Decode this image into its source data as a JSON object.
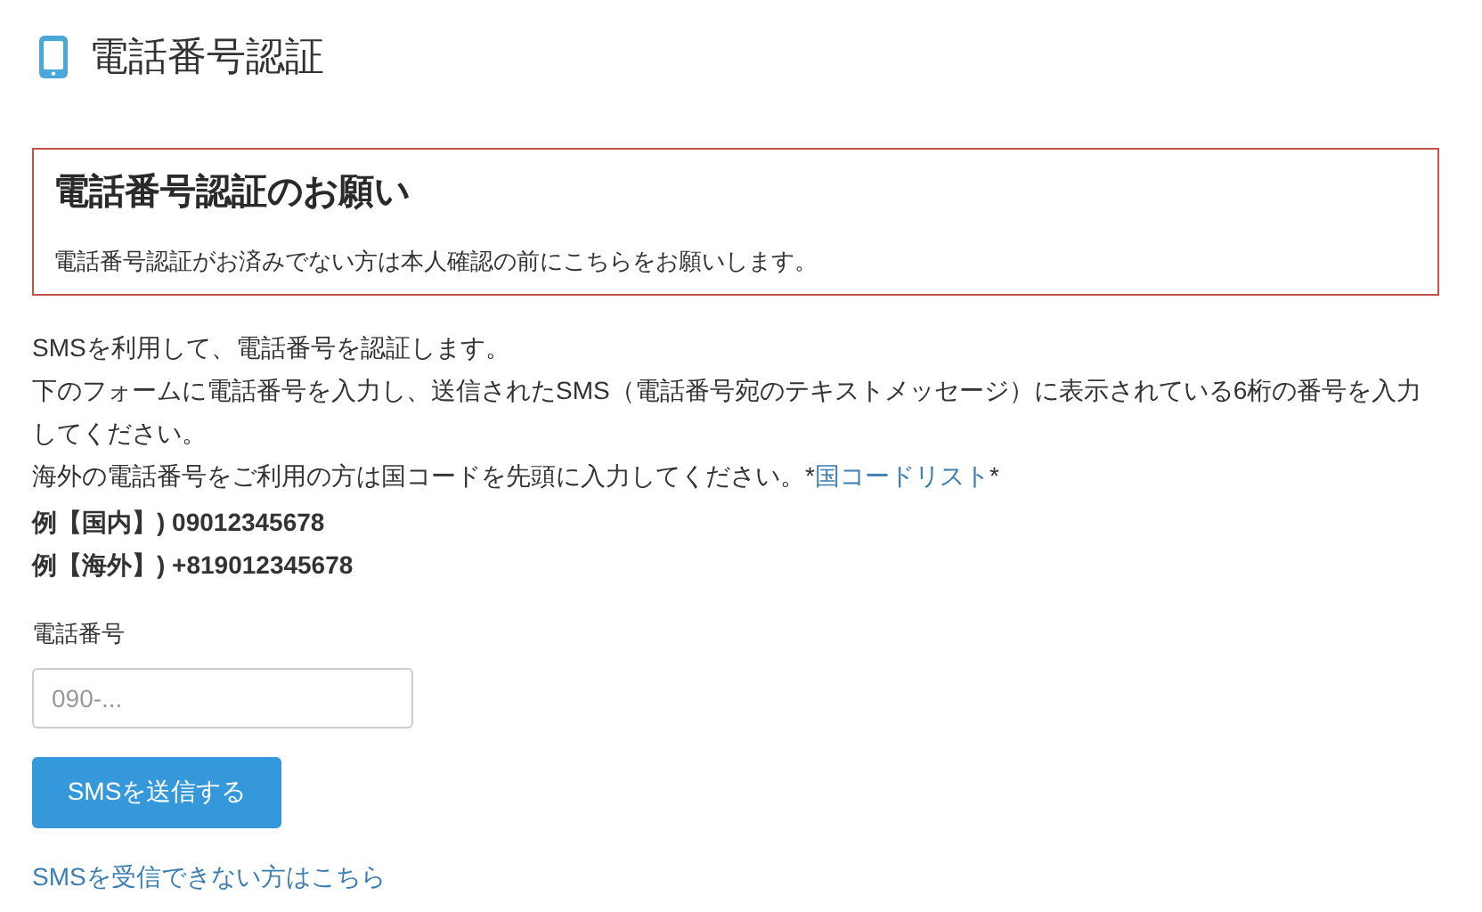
{
  "page_title": "電話番号認証",
  "alert": {
    "heading": "電話番号認証のお願い",
    "message": "電話番号認証がお済みでない方は本人確認の前にこちらをお願いします。"
  },
  "intro": [
    {
      "text": "SMSを利用して、電話番号を認証します。"
    },
    {
      "text": "下のフォームに電話番号を入力し、送信されたSMS（電話番号宛のテキストメッセージ）に表示されている6桁の番号を入力してください。"
    },
    {
      "text": "海外の電話番号をご利用の方は国コードを先頭に入力してください。*",
      "link": "国コードリスト",
      "after": "*"
    }
  ],
  "examples": [
    "例【国内】) 09012345678",
    "例【海外】) +819012345678"
  ],
  "phone_field": {
    "label": "電話番号",
    "placeholder": "090-..."
  },
  "submit_button": "SMSを送信する",
  "help_link": "SMSを受信できない方はこちら"
}
